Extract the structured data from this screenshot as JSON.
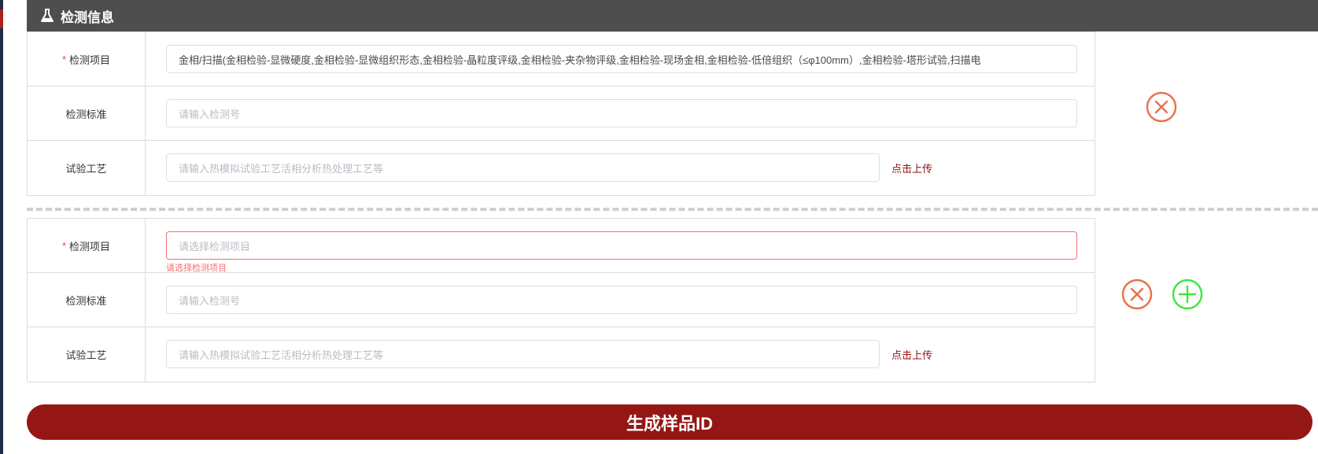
{
  "section": {
    "title": "检测信息",
    "icon": "flask-icon"
  },
  "groups": [
    {
      "item_label": "检测项目",
      "item_value": "金相/扫描(金相检验-显微硬度,金相检验-显微组织形态,金相检验-晶粒度评级,金相检验-夹杂物评级,金相检验-现场金相,金相检验-低倍组织（≤φ100mm）,金相检验-塔形试验,扫描电",
      "standard_label": "检测标准",
      "standard_placeholder": "请输入检测号",
      "process_label": "试验工艺",
      "process_placeholder": "请输入热模拟试验工艺活相分析热处理工艺等",
      "upload_label": "点击上传"
    },
    {
      "item_label": "检测项目",
      "item_placeholder": "请选择检测项目",
      "item_error": "请选择检测项目",
      "standard_label": "检测标准",
      "standard_placeholder": "请输入检测号",
      "process_label": "试验工艺",
      "process_placeholder": "请输入热模拟试验工艺活相分析热处理工艺等",
      "upload_label": "点击上传"
    }
  ],
  "actions": {
    "remove_icon": "close-circle-icon",
    "add_icon": "plus-circle-icon",
    "generate_label": "生成样品ID"
  },
  "colors": {
    "header_bg": "#4f4e4e",
    "remove": "#e8704a",
    "add": "#3ee63e",
    "primary": "#941716",
    "upload_link": "#8e1414",
    "error": "#f56c6c"
  }
}
